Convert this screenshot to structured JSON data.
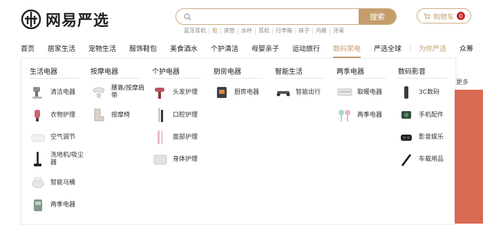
{
  "brand": {
    "name": "网易严选"
  },
  "search": {
    "placeholder": "",
    "button": "搜索"
  },
  "hot_words": [
    "蓝牙耳机",
    "鞋",
    "床垫",
    "水杯",
    "耳机",
    "行李箱",
    "袜子",
    "内裤",
    "牙膏"
  ],
  "cart": {
    "label": "购物车",
    "count": "0"
  },
  "nav": [
    {
      "label": "首页"
    },
    {
      "label": "居家生活"
    },
    {
      "label": "宠物生活"
    },
    {
      "label": "服饰鞋包"
    },
    {
      "label": "美食酒水"
    },
    {
      "label": "个护清洁"
    },
    {
      "label": "母婴亲子"
    },
    {
      "label": "运动旅行"
    },
    {
      "label": "数码家电"
    },
    {
      "label": "严选全球"
    },
    {
      "label": "为你严选"
    },
    {
      "label": "众筹"
    }
  ],
  "panel": {
    "columns": [
      {
        "title": "生活电器",
        "items": [
          "清洁电器",
          "衣物护理",
          "空气调节",
          "洗地机/吸尘器",
          "智能马桶",
          "两季电器"
        ]
      },
      {
        "title": "按摩电器",
        "items": [
          "腰靠/按摩肩带",
          "按摩椅"
        ]
      },
      {
        "title": "个护电器",
        "items": [
          "头发护理",
          "口腔护理",
          "面部护理",
          "身体护理"
        ]
      },
      {
        "title": "厨房电器",
        "items": [
          "厨房电器"
        ]
      },
      {
        "title": "智能生活",
        "items": [
          "智能出行"
        ]
      },
      {
        "title": "两季电器",
        "items": [
          "取暖电器",
          "两季电器"
        ]
      },
      {
        "title": "数码影音",
        "items": [
          "3C数码",
          "手机配件",
          "影音娱乐",
          "车载用品"
        ]
      }
    ]
  },
  "side": {
    "more": "更多"
  },
  "colors": {
    "accent": "#c59d6d",
    "badge": "#c1272d",
    "strip": "#d96a52"
  }
}
